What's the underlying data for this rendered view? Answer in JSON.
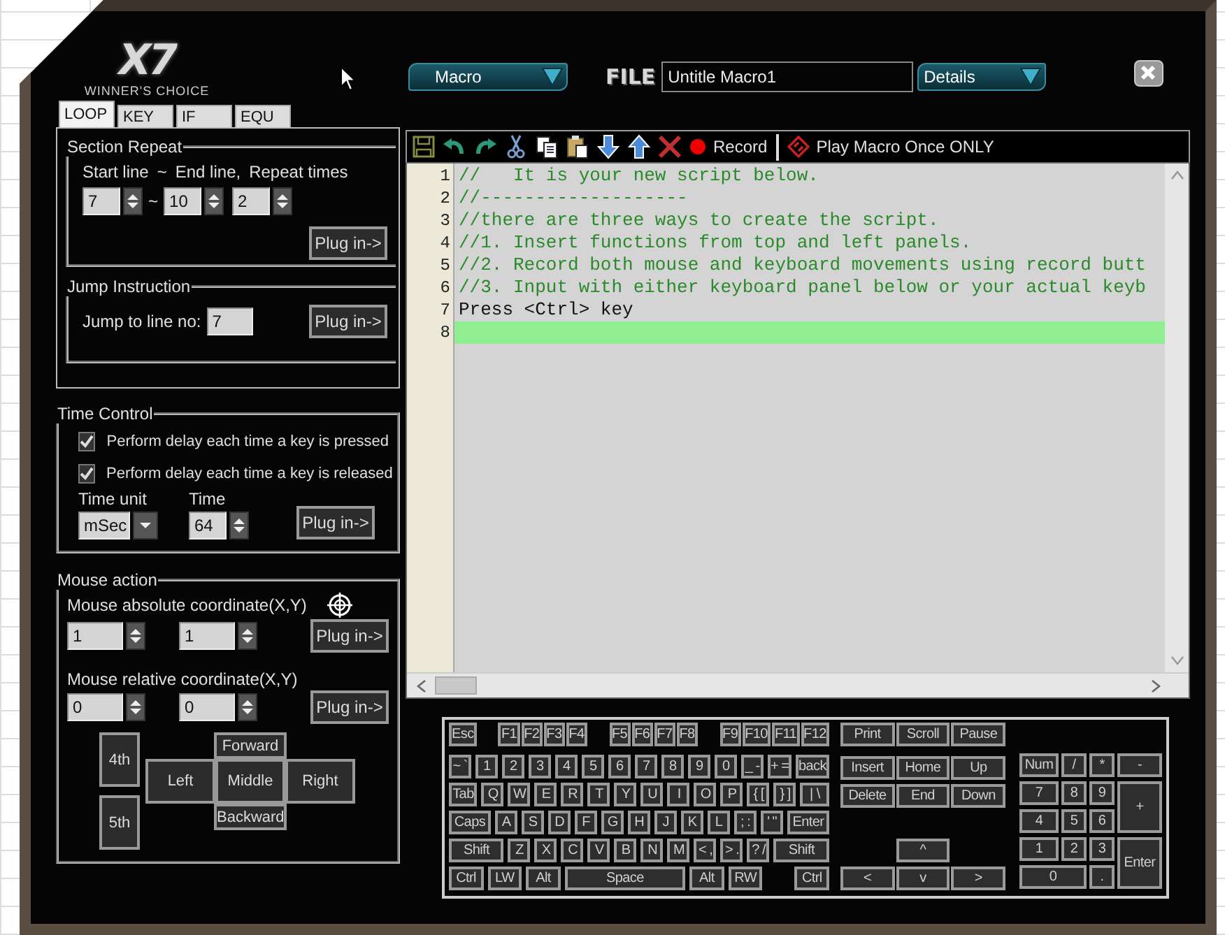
{
  "logo": {
    "brand": "X7",
    "tagline": "WINNER'S CHOICE"
  },
  "tabs": [
    {
      "label": "LOOP",
      "selected": true
    },
    {
      "label": "KEY",
      "selected": false
    },
    {
      "label": "IF",
      "selected": false
    },
    {
      "label": "EQU",
      "selected": false
    }
  ],
  "section_repeat": {
    "title": "Section Repeat",
    "start_label": "Start line",
    "range_sign": "~",
    "end_label": "End line,",
    "repeat_label": "Repeat times",
    "start_value": "7",
    "field_sign": "~",
    "end_value": "10",
    "repeat_value": "2",
    "button": "Plug in->"
  },
  "jump_instruction": {
    "title": "Jump Instruction",
    "label": "Jump to line no:",
    "value": "7",
    "button": "Plug in->"
  },
  "time_control": {
    "title": "Time Control",
    "options": [
      {
        "label": "Perform delay each time a key is pressed",
        "checked": true
      },
      {
        "label": "Perform delay each time a key is released",
        "checked": true
      }
    ],
    "unit_label": "Time unit",
    "unit_value": "mSec",
    "time_label": "Time",
    "time_value": "64",
    "button": "Plug in->"
  },
  "mouse_action": {
    "title": "Mouse action",
    "absolute_label": "Mouse absolute coordinate(X,Y)",
    "absolute_values": [
      "1",
      "1"
    ],
    "absolute_button": "Plug in->",
    "relative_label": "Mouse relative coordinate(X,Y)",
    "relative_values": [
      "0",
      "0"
    ],
    "relative_button": "Plug in->",
    "side_buttons": [
      "4th",
      "5th"
    ],
    "buttons": [
      {
        "label": "Forward",
        "kind": "forward"
      },
      {
        "label": "Left",
        "kind": "left"
      },
      {
        "label": "Middle",
        "kind": "middle"
      },
      {
        "label": "Right",
        "kind": "right"
      },
      {
        "label": "Backward",
        "kind": "backward"
      }
    ]
  },
  "header": {
    "mode": "Macro",
    "file_label": "FILE",
    "file_name": "Untitle Macro1",
    "view": "Details"
  },
  "toolbar": {
    "record": "Record",
    "play": "Play Macro Once ONLY"
  },
  "editor": {
    "lines": [
      {
        "number": "1",
        "text": "//   It is your new script below.",
        "kind": "comment",
        "selected": false
      },
      {
        "number": "2",
        "text": "//-------------------",
        "kind": "comment",
        "selected": false
      },
      {
        "number": "3",
        "text": "//there are three ways to create the script.",
        "kind": "comment",
        "selected": false
      },
      {
        "number": "4",
        "text": "//1. Insert functions from top and left panels.",
        "kind": "comment",
        "selected": false
      },
      {
        "number": "5",
        "text": "//2. Record both mouse and keyboard movements using record butt",
        "kind": "comment",
        "selected": false
      },
      {
        "number": "6",
        "text": "//3. Input with either keyboard panel below or your actual keyb",
        "kind": "comment",
        "selected": false
      },
      {
        "number": "7",
        "text": "Press <Ctrl> key",
        "kind": "code",
        "selected": false
      },
      {
        "number": "8",
        "kind": "code",
        "selected": true
      }
    ]
  },
  "keyboard": {
    "function_groups": [
      [
        "Esc"
      ],
      [
        "F1",
        "F2",
        "F3",
        "F4"
      ],
      [
        "F5",
        "F6",
        "F7",
        "F8"
      ],
      [
        "F9",
        "F10",
        "F11",
        "F12"
      ]
    ],
    "main_rows": [
      [
        {
          "label": "~ `",
          "kind": "key"
        },
        {
          "label": "1",
          "kind": "key"
        },
        {
          "label": "2",
          "kind": "key"
        },
        {
          "label": "3",
          "kind": "key"
        },
        {
          "label": "4",
          "kind": "key"
        },
        {
          "label": "5",
          "kind": "key"
        },
        {
          "label": "6",
          "kind": "key"
        },
        {
          "label": "7",
          "kind": "key"
        },
        {
          "label": "8",
          "kind": "key"
        },
        {
          "label": "9",
          "kind": "key"
        },
        {
          "label": "0",
          "kind": "key"
        },
        {
          "label": "_ -",
          "kind": "key"
        },
        {
          "label": "+ =",
          "kind": "key"
        },
        {
          "label": "back",
          "kind": "wide"
        }
      ],
      [
        {
          "label": "Tab",
          "kind": "wide"
        },
        {
          "label": "Q",
          "kind": "key"
        },
        {
          "label": "W",
          "kind": "key"
        },
        {
          "label": "E",
          "kind": "key"
        },
        {
          "label": "R",
          "kind": "key"
        },
        {
          "label": "T",
          "kind": "key"
        },
        {
          "label": "Y",
          "kind": "key"
        },
        {
          "label": "U",
          "kind": "key"
        },
        {
          "label": "I",
          "kind": "key"
        },
        {
          "label": "O",
          "kind": "key"
        },
        {
          "label": "P",
          "kind": "key"
        },
        {
          "label": "{ [",
          "kind": "key"
        },
        {
          "label": "} ]",
          "kind": "key"
        },
        {
          "label": "| \\",
          "kind": "wide"
        }
      ],
      [
        {
          "label": "Caps",
          "kind": "wide"
        },
        {
          "label": "A",
          "kind": "key"
        },
        {
          "label": "S",
          "kind": "key"
        },
        {
          "label": "D",
          "kind": "key"
        },
        {
          "label": "F",
          "kind": "key"
        },
        {
          "label": "G",
          "kind": "key"
        },
        {
          "label": "H",
          "kind": "key"
        },
        {
          "label": "J",
          "kind": "key"
        },
        {
          "label": "K",
          "kind": "key"
        },
        {
          "label": "L",
          "kind": "key"
        },
        {
          "label": "; :",
          "kind": "key"
        },
        {
          "label": "' \"",
          "kind": "key"
        },
        {
          "label": "Enter",
          "kind": "wide"
        }
      ],
      [
        {
          "label": "Shift",
          "kind": "wide"
        },
        {
          "label": "Z",
          "kind": "key"
        },
        {
          "label": "X",
          "kind": "key"
        },
        {
          "label": "C",
          "kind": "key"
        },
        {
          "label": "V",
          "kind": "key"
        },
        {
          "label": "B",
          "kind": "key"
        },
        {
          "label": "N",
          "kind": "key"
        },
        {
          "label": "M",
          "kind": "key"
        },
        {
          "label": "< ,",
          "kind": "key"
        },
        {
          "label": "> .",
          "kind": "key"
        },
        {
          "label": "? /",
          "kind": "key"
        },
        {
          "label": "Shift",
          "kind": "wide"
        }
      ],
      [
        {
          "label": "Ctrl",
          "kind": "wide"
        },
        {
          "label": "LW",
          "kind": "wide"
        },
        {
          "label": "Alt",
          "kind": "wide"
        },
        {
          "label": "Space",
          "kind": "space"
        },
        {
          "label": "Alt",
          "kind": "wide"
        },
        {
          "label": "RW",
          "kind": "wide"
        },
        {
          "label": "Ctrl",
          "kind": "far"
        }
      ]
    ],
    "nav_rows": [
      [
        "Print",
        "Scroll",
        "Pause"
      ],
      [
        "Insert",
        "Home",
        "Up"
      ],
      [
        "Delete",
        "End",
        "Down"
      ]
    ],
    "arrows": [
      "^",
      "<",
      "v",
      ">"
    ],
    "numpad": [
      {
        "label": "Num",
        "kind": "key"
      },
      {
        "label": "/",
        "kind": "key"
      },
      {
        "label": "*",
        "kind": "key"
      },
      {
        "label": "-",
        "kind": "key"
      },
      {
        "label": "7",
        "kind": "key"
      },
      {
        "label": "8",
        "kind": "key"
      },
      {
        "label": "9",
        "kind": "key"
      },
      {
        "label": "+",
        "kind": "tall"
      },
      {
        "label": "4",
        "kind": "key"
      },
      {
        "label": "5",
        "kind": "key"
      },
      {
        "label": "6",
        "kind": "key"
      },
      {
        "label": "1",
        "kind": "key"
      },
      {
        "label": "2",
        "kind": "key"
      },
      {
        "label": "3",
        "kind": "key"
      },
      {
        "label": "Enter",
        "kind": "tall"
      },
      {
        "label": "0",
        "kind": "wide"
      },
      {
        "label": ".",
        "kind": "key"
      }
    ]
  }
}
